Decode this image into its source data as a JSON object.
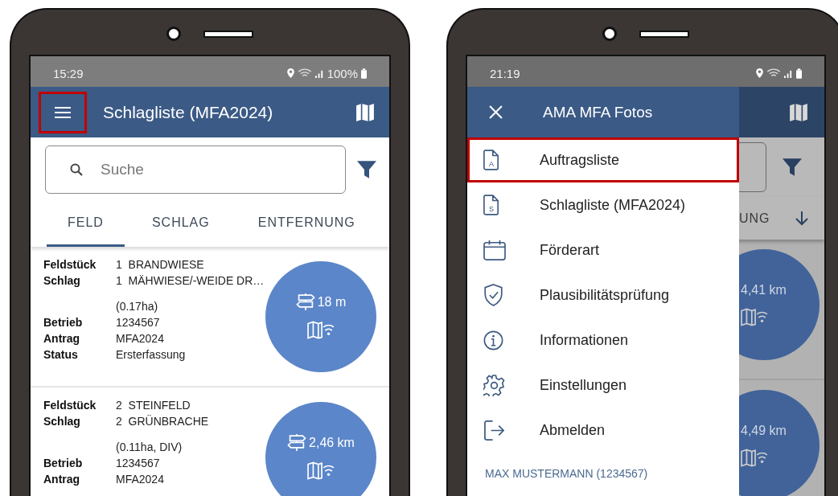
{
  "left_phone": {
    "status_bar": {
      "time": "15:29",
      "battery": "100%"
    },
    "app_bar": {
      "title": "Schlagliste (MFA2024)",
      "menu_highlighted": true
    },
    "search": {
      "placeholder": "Suche"
    },
    "sort_tabs": [
      {
        "label": "FELD",
        "selected": true
      },
      {
        "label": "SCHLAG",
        "selected": false
      },
      {
        "label": "ENTFERNUNG",
        "selected": false
      }
    ],
    "records": [
      {
        "distance": "18 m",
        "rows": [
          {
            "label": "Feldstück",
            "value": "1  BRANDWIESE"
          },
          {
            "label": "Schlag",
            "value": "1  MÄHWIESE/-WEIDE DR…"
          },
          {
            "value": "(0.17ha)"
          },
          {
            "label": "Betrieb",
            "value": "1234567"
          },
          {
            "label": "Antrag",
            "value": "MFA2024"
          },
          {
            "label": "Status",
            "value": "Ersterfassung"
          }
        ]
      },
      {
        "distance": "2,46 km",
        "rows": [
          {
            "label": "Feldstück",
            "value": "2  STEINFELD"
          },
          {
            "label": "Schlag",
            "value": "2  GRÜNBRACHE"
          },
          {
            "value": "(0.11ha, DIV)"
          },
          {
            "label": "Betrieb",
            "value": "1234567"
          },
          {
            "label": "Antrag",
            "value": "MFA2024"
          }
        ]
      }
    ]
  },
  "right_phone": {
    "status_bar": {
      "time": "21:19"
    },
    "background": {
      "tab_fragment": "UNG",
      "distances": [
        "4,41 km",
        "4,49 km"
      ]
    },
    "drawer": {
      "title": "AMA MFA Fotos",
      "items": [
        {
          "kind": "document",
          "icon_letter": "A",
          "label": "Auftragsliste",
          "highlighted": true
        },
        {
          "kind": "document",
          "icon_letter": "S",
          "label": "Schlagliste (MFA2024)",
          "highlighted": false
        },
        {
          "kind": "calendar",
          "label": "Förderart",
          "highlighted": false
        },
        {
          "kind": "shield",
          "label": "Plausibilitätsprüfung",
          "highlighted": false
        },
        {
          "kind": "info",
          "label": "Informationen",
          "highlighted": false
        },
        {
          "kind": "gear",
          "label": "Einstellungen",
          "highlighted": false
        },
        {
          "kind": "logout",
          "label": "Abmelden",
          "highlighted": false
        }
      ],
      "user": "MAX MUSTERMANN (1234567)"
    }
  }
}
